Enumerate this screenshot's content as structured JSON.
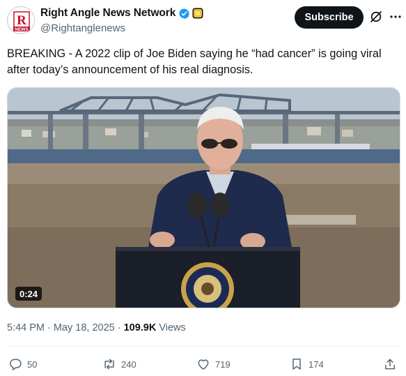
{
  "account": {
    "display_name": "Right Angle News Network",
    "handle": "@Rightanglenews",
    "avatar_letters": "R",
    "avatar_caption": "NEWS"
  },
  "header": {
    "subscribe_label": "Subscribe"
  },
  "tweet": {
    "text": "BREAKING - A 2022 clip of Joe Biden saying he “had cancer” is going viral after today’s announcement of his real diagnosis."
  },
  "media": {
    "duration": "0:24"
  },
  "meta": {
    "time": "5:44 PM",
    "separator": "·",
    "date": "May 18, 2025",
    "views_count": "109.9K",
    "views_label": "Views"
  },
  "actions": {
    "replies": "50",
    "reposts": "240",
    "likes": "719",
    "bookmarks": "174"
  },
  "icons": {
    "verified": "verified-badge-icon",
    "affiliate": "gold-affiliate-icon",
    "grok": "grok-icon",
    "more": "more-icon",
    "reply": "reply-icon",
    "repost": "repost-icon",
    "like": "like-icon",
    "bookmark": "bookmark-icon",
    "share": "share-icon"
  },
  "colors": {
    "text": "#0f1419",
    "secondary": "#536471",
    "verified_blue": "#1d9bf0",
    "brand_red": "#c8102e"
  }
}
